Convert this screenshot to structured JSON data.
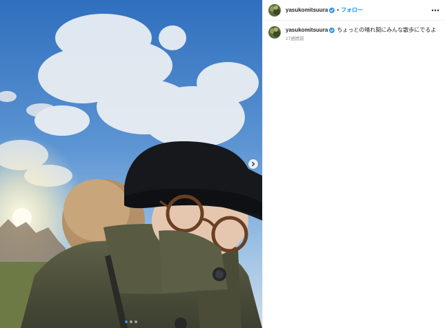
{
  "post": {
    "slide_count": 3,
    "active_slide": 1
  },
  "header": {
    "username": "yasukomitsuura",
    "separator": "•",
    "follow_label": "フォロー",
    "more_icon": "more-horizontal-icon"
  },
  "caption": {
    "username": "yasukomitsuura",
    "text": "ちょっとの晴れ間にみんな散歩にでるよ",
    "timestamp": "27週間前"
  },
  "colors": {
    "accent": "#0095f6",
    "verified": "#3897f0",
    "text": "#262626",
    "muted": "#8e8e8e"
  }
}
